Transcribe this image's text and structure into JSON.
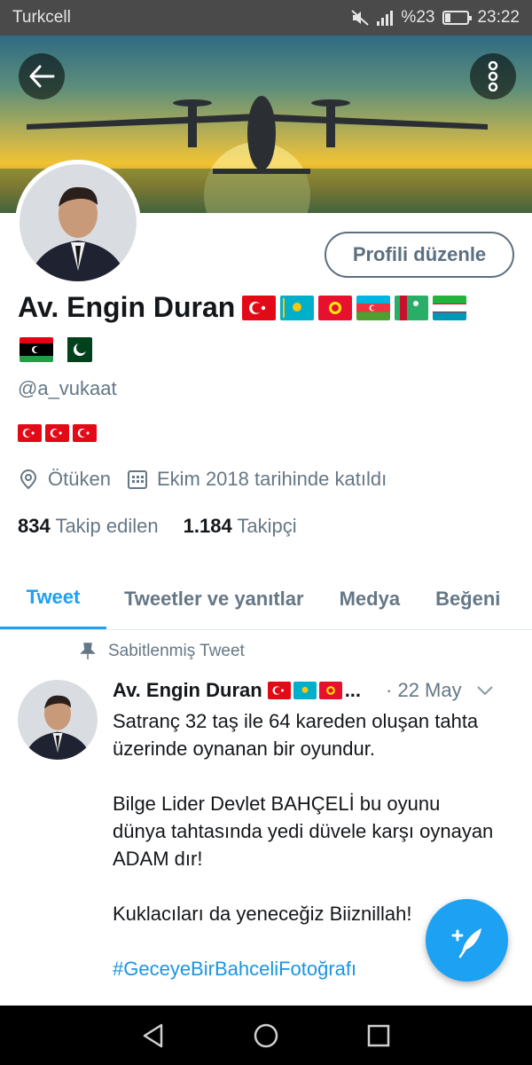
{
  "status_bar": {
    "carrier": "Turkcell",
    "battery": "%23",
    "time": "23:22",
    "battery_level": 0.23
  },
  "profile": {
    "edit_button": "Profili düzenle",
    "display_name": "Av. Engin Duran",
    "name_flags": [
      "turkey-flag-icon",
      "kazakhstan-flag-icon",
      "kyrgyzstan-flag-icon",
      "azerbaijan-flag-icon",
      "turkmenistan-flag-icon",
      "uzbekistan-flag-icon",
      "libya-flag-icon",
      "pakistan-flag-icon"
    ],
    "handle": "@a_vukaat",
    "bio_flags": [
      "turkey-flag-icon",
      "turkey-flag-icon",
      "turkey-flag-icon"
    ],
    "location": "Ötüken",
    "joined": "Ekim 2018 tarihinde katıldı",
    "following_count": "834",
    "following_label": "Takip edilen",
    "followers_count": "1.184",
    "followers_label": "Takipçi"
  },
  "tabs": [
    {
      "label": "Tweet",
      "active": true
    },
    {
      "label": "Tweetler ve yanıtlar",
      "active": false
    },
    {
      "label": "Medya",
      "active": false
    },
    {
      "label": "Beğeni",
      "active": false
    }
  ],
  "pinned_tweet": {
    "pinned_label": "Sabitlenmiş Tweet",
    "author_name": "Av. Engin Duran",
    "ellipsis": "...",
    "date": "· 22 May",
    "paragraphs": [
      "Satranç 32 taş ile 64 kareden oluşan tahta üzerinde oynanan bir oyundur.",
      "Bilge Lider Devlet BAHÇELİ bu oyunu dünya tahtasında yedi düvele karşı oynayan ADAM dır!",
      "Kuklacıları da yeneceğiz Biiznillah!"
    ],
    "hashtag": "#GeceyeBirBahceliFotoğrafı"
  },
  "colors": {
    "accent": "#1da1f2",
    "secondary_text": "#657786",
    "primary_text": "#14171a"
  }
}
